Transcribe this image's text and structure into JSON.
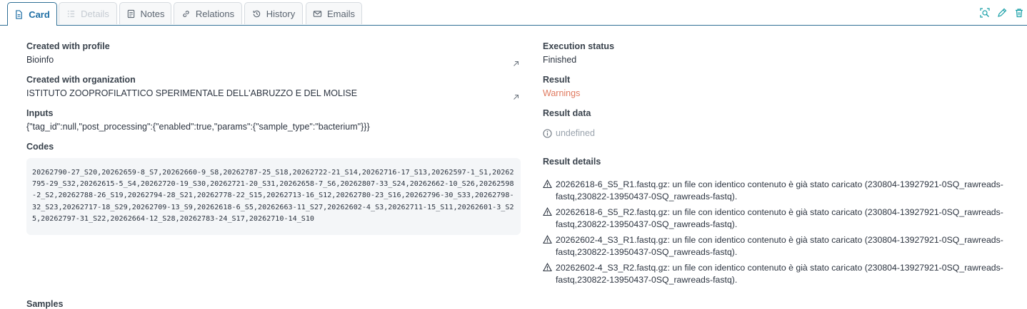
{
  "tabs": [
    {
      "label": "Card",
      "icon": "document-icon",
      "state": "active"
    },
    {
      "label": "Details",
      "icon": "list-icon",
      "state": "disabled"
    },
    {
      "label": "Notes",
      "icon": "note-icon",
      "state": "normal"
    },
    {
      "label": "Relations",
      "icon": "link-icon",
      "state": "normal"
    },
    {
      "label": "History",
      "icon": "history-icon",
      "state": "normal"
    },
    {
      "label": "Emails",
      "icon": "mail-icon",
      "state": "normal"
    }
  ],
  "toolbar": {
    "icons": [
      "search-zoom-icon",
      "edit-icon",
      "delete-icon"
    ],
    "accent": "#1aa0a8"
  },
  "left": {
    "profile": {
      "label": "Created with profile",
      "value": "Bioinfo"
    },
    "organization": {
      "label": "Created with organization",
      "value": "ISTITUTO ZOOPROFILATTICO SPERIMENTALE DELL'ABRUZZO E DEL MOLISE"
    },
    "inputs": {
      "label": "Inputs",
      "value": "{\"tag_id\":null,\"post_processing\":{\"enabled\":true,\"params\":{\"sample_type\":\"bacterium\"}}}"
    },
    "codes": {
      "label": "Codes",
      "value": "20262790-27_S20,20262659-8_S7,20262660-9_S8,20262787-25_S18,20262722-21_S14,20262716-17_S13,20262597-1_S1,20262795-29_S32,20262615-5_S4,20262720-19_S30,20262721-20_S31,20262658-7_S6,20262807-33_S24,20262662-10_S26,20262598-2_S2,20262788-26_S19,20262794-28_S21,20262778-22_S15,20262713-16_S12,20262780-23_S16,20262796-30_S33,20262798-32_S23,20262717-18_S29,20262709-13_S9,20262618-6_S5,20262663-11_S27,20262602-4_S3,20262711-15_S11,20262601-3_S25,20262797-31_S22,20262664-12_S28,20262783-24_S17,20262710-14_S10"
    },
    "next_label": "Samples"
  },
  "right": {
    "execution_status": {
      "label": "Execution status",
      "value": "Finished"
    },
    "result": {
      "label": "Result",
      "value": "Warnings",
      "color": "#e07a5f"
    },
    "result_data": {
      "label": "Result data",
      "value": "undefined"
    },
    "result_details": {
      "label": "Result details",
      "items": [
        "20262618-6_S5_R1.fastq.gz: un file con identico contenuto è già stato caricato (230804-13927921-0SQ_rawreads-fastq,230822-13950437-0SQ_rawreads-fastq).",
        "20262618-6_S5_R2.fastq.gz: un file con identico contenuto è già stato caricato (230804-13927921-0SQ_rawreads-fastq,230822-13950437-0SQ_rawreads-fastq).",
        "20262602-4_S3_R1.fastq.gz: un file con identico contenuto è già stato caricato (230804-13927921-0SQ_rawreads-fastq,230822-13950437-0SQ_rawreads-fastq).",
        "20262602-4_S3_R2.fastq.gz: un file con identico contenuto è già stato caricato (230804-13927921-0SQ_rawreads-fastq,230822-13950437-0SQ_rawreads-fastq)."
      ]
    }
  }
}
